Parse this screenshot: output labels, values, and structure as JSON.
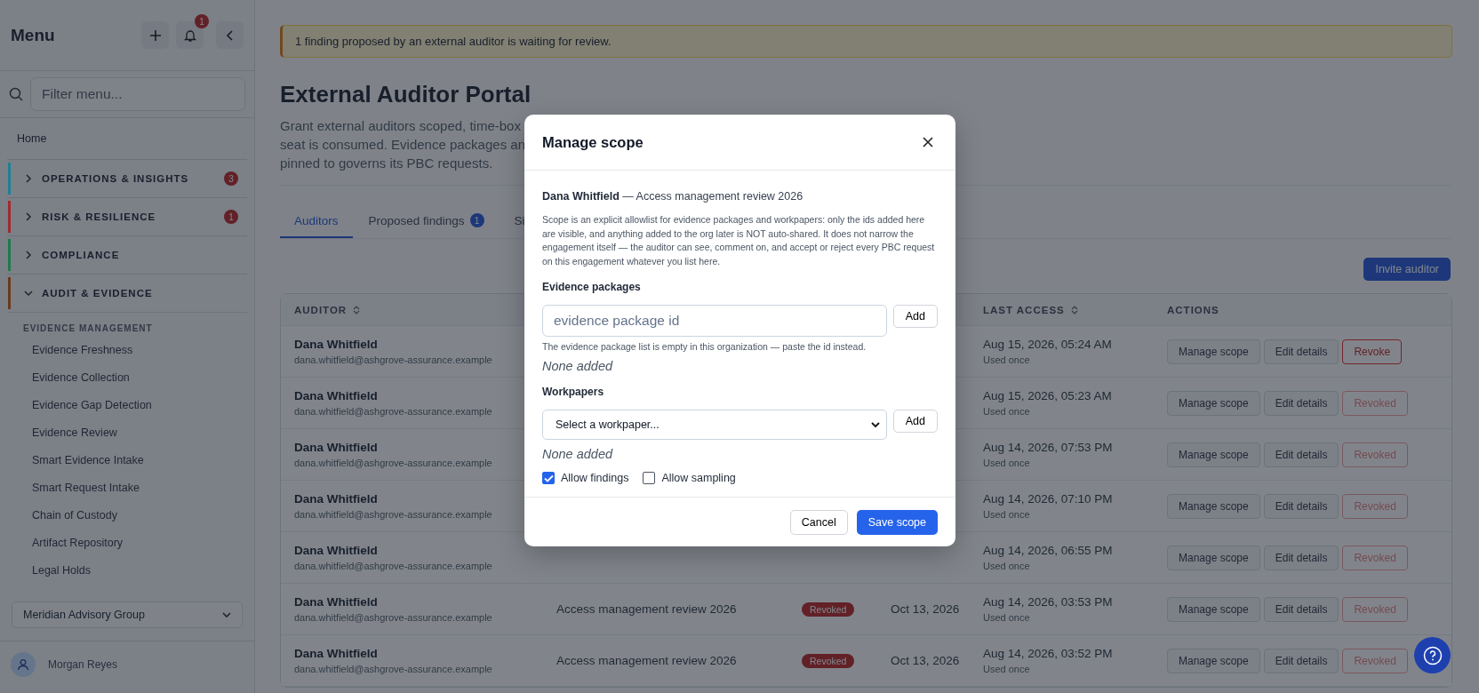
{
  "sidebar": {
    "title": "Menu",
    "notification_count": "1",
    "filter": {
      "placeholder": "Filter menu..."
    },
    "home": "Home",
    "groups": [
      {
        "label": "OPERATIONS & INSIGHTS",
        "color": "#1f7f96",
        "expanded": false,
        "badge": "3"
      },
      {
        "label": "RISK & RESILIENCE",
        "color": "#a12a2e",
        "expanded": false,
        "badge": "1"
      },
      {
        "label": "COMPLIANCE",
        "color": "#1f7a4a",
        "expanded": false
      },
      {
        "label": "AUDIT & EVIDENCE",
        "color": "#6b3a1e",
        "expanded": true,
        "section": "EVIDENCE MANAGEMENT",
        "children": [
          {
            "label": "Evidence Freshness"
          },
          {
            "label": "Evidence Collection"
          },
          {
            "label": "Evidence Gap Detection"
          },
          {
            "label": "Evidence Review"
          },
          {
            "label": "Smart Evidence Intake"
          },
          {
            "label": "Smart Request Intake"
          },
          {
            "label": "Chain of Custody"
          },
          {
            "label": "Artifact Repository"
          },
          {
            "label": "Legal Holds"
          }
        ]
      }
    ],
    "org_select": "Meridian Advisory Group",
    "user": "Morgan Reyes"
  },
  "banner": "1 finding proposed by an external auditor is waiting for review.",
  "page": {
    "title": "External Auditor Portal",
    "description_lines": [
      "Grant external auditors scoped, time-box",
      "seat is consumed. Evidence packages an",
      "pinned to governs its PBC requests."
    ],
    "tabs": [
      {
        "label": "Auditors",
        "selected": true
      },
      {
        "label": "Proposed findings",
        "badge": "1",
        "selected": false
      },
      {
        "label": "Si",
        "selected": false
      }
    ],
    "invite_button": "Invite auditor"
  },
  "table": {
    "columns": [
      {
        "label": "AUDITOR",
        "sortable": true
      },
      {
        "label": "LAST ACCESS",
        "sortable": true
      },
      {
        "label": "ACTIONS",
        "sortable": false
      }
    ],
    "rows": [
      {
        "name": "Dana Whitfield",
        "email": "dana.whitfield@ashgrove-assurance.example",
        "last_access": "Aug 15, 2026, 05:24 AM",
        "usage": "Used once",
        "actions": [
          "Manage scope",
          "Edit details",
          "Revoke"
        ],
        "revoked": false
      },
      {
        "name": "Dana Whitfield",
        "email": "dana.whitfield@ashgrove-assurance.example",
        "last_access": "Aug 15, 2026, 05:23 AM",
        "usage": "Used once",
        "actions": [
          "Manage scope",
          "Edit details",
          "Revoked"
        ],
        "revoked": true
      },
      {
        "name": "Dana Whitfield",
        "email": "dana.whitfield@ashgrove-assurance.example",
        "last_access": "Aug 14, 2026, 07:53 PM",
        "usage": "Used once",
        "actions": [
          "Manage scope",
          "Edit details",
          "Revoked"
        ],
        "revoked": true
      },
      {
        "name": "Dana Whitfield",
        "email": "dana.whitfield@ashgrove-assurance.example",
        "last_access": "Aug 14, 2026, 07:10 PM",
        "usage": "Used once",
        "actions": [
          "Manage scope",
          "Edit details",
          "Revoked"
        ],
        "revoked": true
      },
      {
        "name": "Dana Whitfield",
        "email": "dana.whitfield@ashgrove-assurance.example",
        "last_access": "Aug 14, 2026, 06:55 PM",
        "usage": "Used once",
        "actions": [
          "Manage scope",
          "Edit details",
          "Revoked"
        ],
        "revoked": true
      },
      {
        "name": "Dana Whitfield",
        "email": "dana.whitfield@ashgrove-assurance.example",
        "engagement": "Access management review 2026",
        "status": "Revoked",
        "expires": "Oct 13, 2026",
        "last_access": "Aug 14, 2026, 03:53 PM",
        "usage": "Used once",
        "actions": [
          "Manage scope",
          "Edit details",
          "Revoked"
        ],
        "revoked": true
      },
      {
        "name": "Dana Whitfield",
        "email": "dana.whitfield@ashgrove-assurance.example",
        "engagement": "Access management review 2026",
        "status": "Revoked",
        "expires": "Oct 13, 2026",
        "last_access": "Aug 14, 2026, 03:52 PM",
        "usage": "Used once",
        "actions": [
          "Manage scope",
          "Edit details",
          "Revoked"
        ],
        "revoked": true
      }
    ]
  },
  "modal": {
    "title": "Manage scope",
    "subject": "**Dana Whitfield** — Access management review 2026",
    "explanation": "Scope is an explicit allowlist for evidence packages and workpapers: only the ids added here are visible, and anything added to the org later is NOT auto-shared. It does not narrow the engagement itself — the auditor can see, comment on, and accept or reject every PBC request on this engagement whatever you list here.",
    "sections": [
      {
        "kind": "input",
        "label": "Evidence packages",
        "placeholder": "evidence package id",
        "add_button": "Add",
        "hint": "The evidence package list is empty in this organization — paste the id instead.",
        "empty": "None added"
      },
      {
        "kind": "select",
        "label": "Workpapers",
        "value": "Select a workpaper...",
        "add_button": "Add",
        "empty": "None added"
      }
    ],
    "checkboxes": [
      {
        "label": "Allow findings",
        "checked": true
      },
      {
        "label": "Allow sampling",
        "checked": false
      }
    ],
    "cancel_button": "Cancel",
    "save_button": "Save scope"
  }
}
